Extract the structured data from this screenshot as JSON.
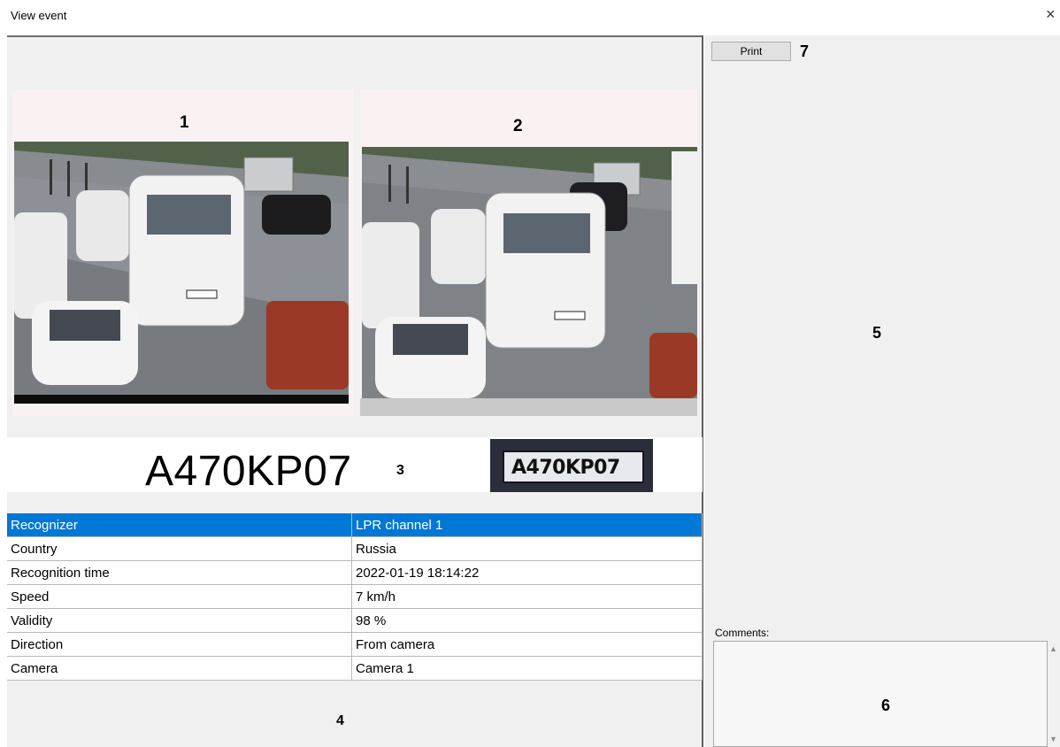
{
  "window": {
    "title": "View event",
    "close_glyph": "×"
  },
  "photos": [
    {
      "number": "1"
    },
    {
      "number": "2"
    }
  ],
  "plate": {
    "text": "A470KP07",
    "crop_text": "A470KP07",
    "number": "3"
  },
  "properties": [
    {
      "key": "Recognizer",
      "value": "LPR channel  1",
      "selected": true
    },
    {
      "key": "Country",
      "value": "Russia"
    },
    {
      "key": "Recognition time",
      "value": "2022-01-19 18:14:22"
    },
    {
      "key": "Speed",
      "value": "7 km/h"
    },
    {
      "key": "Validity",
      "value": "98 %"
    },
    {
      "key": "Direction",
      "value": "From camera"
    },
    {
      "key": "Camera",
      "value": "Camera 1"
    }
  ],
  "table_number": "4",
  "right_panel": {
    "print_label": "Print",
    "print_number": "7",
    "preview_number": "5",
    "comments_label": "Comments:",
    "comments_number": "6",
    "comments_value": ""
  },
  "colors": {
    "selection": "#0078d7",
    "pane": "#f0f0f0"
  }
}
